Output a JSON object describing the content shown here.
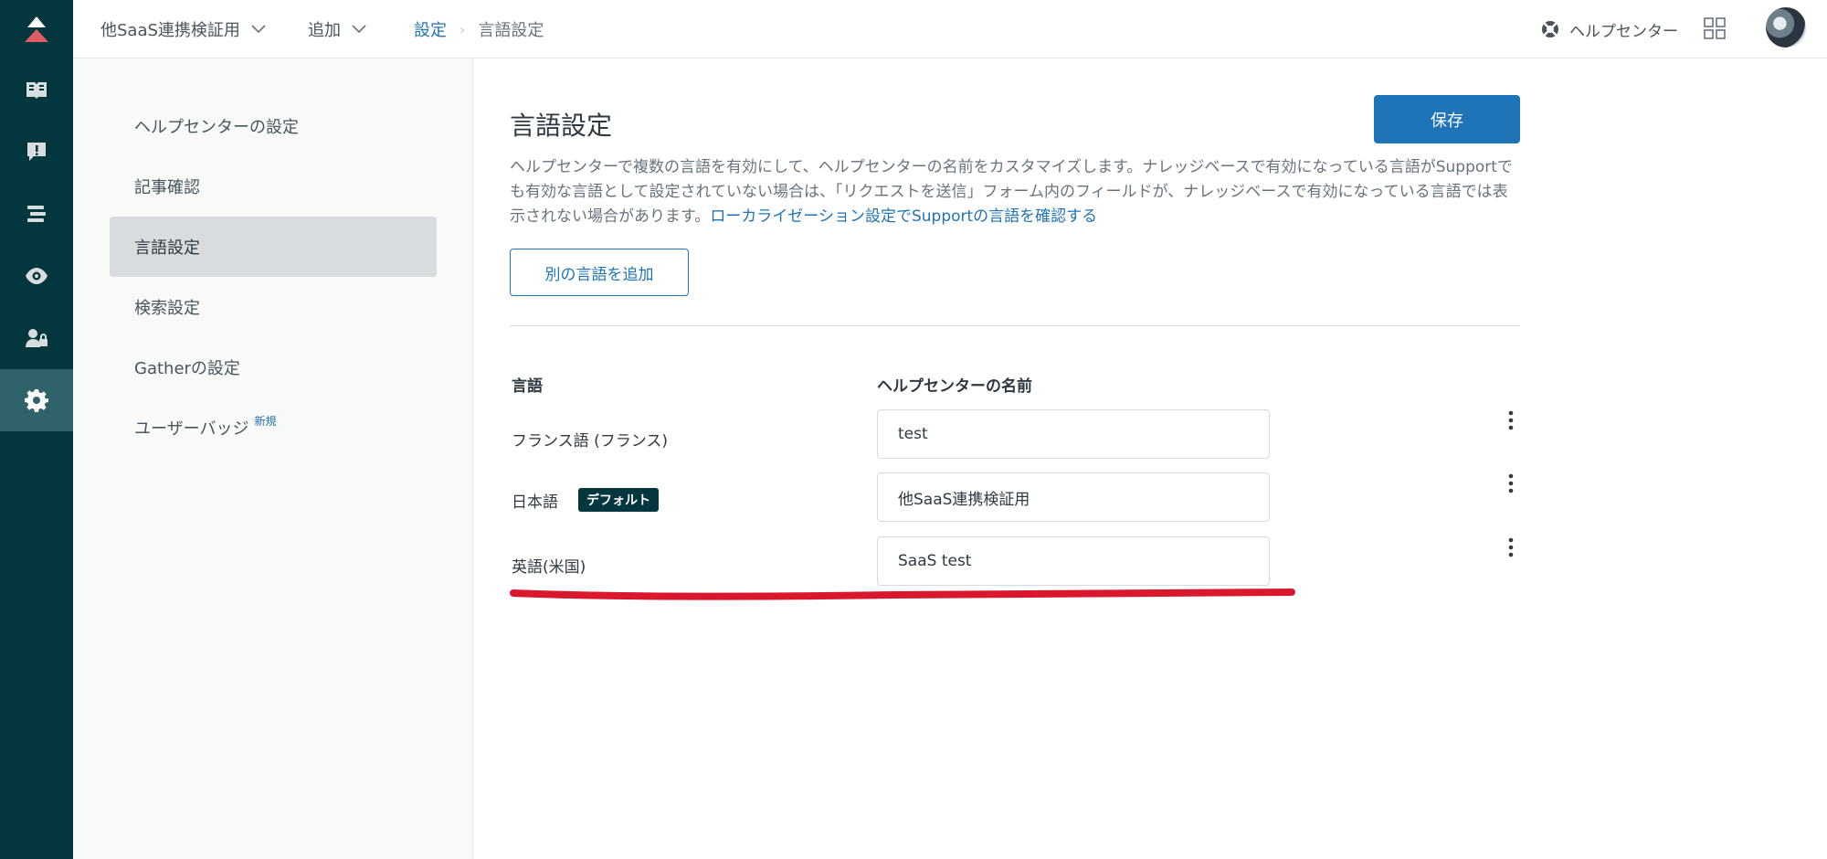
{
  "topbar": {
    "workspace_label": "他SaaS連携検証用",
    "add_label": "追加",
    "breadcrumb_parent": "設定",
    "breadcrumb_current": "言語設定",
    "help_center_label": "ヘルプセンター"
  },
  "sidebar": {
    "items": [
      {
        "label": "ヘルプセンターの設定"
      },
      {
        "label": "記事確認"
      },
      {
        "label": "言語設定",
        "active": true
      },
      {
        "label": "検索設定"
      },
      {
        "label": "Gatherの設定"
      },
      {
        "label": "ユーザーバッジ",
        "tag": "新規"
      }
    ]
  },
  "main": {
    "title": "言語設定",
    "save_label": "保存",
    "description": "ヘルプセンターで複数の言語を有効にして、ヘルプセンターの名前をカスタマイズします。ナレッジベースで有効になっている言語がSupportでも有効な言語として設定されていない場合は、「リクエストを送信」フォーム内のフィールドが、ナレッジベースで有効になっている言語では表示されない場合があります。",
    "description_link": "ローカライゼーション設定でSupportの言語を確認する",
    "add_language_label": "別の言語を追加",
    "col_language": "言語",
    "col_name": "ヘルプセンターの名前",
    "rows": [
      {
        "language": "フランス語 (フランス)",
        "name": "test"
      },
      {
        "language": "日本語",
        "badge": "デフォルト",
        "name": "他SaaS連携検証用"
      },
      {
        "language": "英語(米国)",
        "name": "SaaS test"
      }
    ]
  },
  "colors": {
    "rail_bg": "#03363d",
    "rail_active": "#30626a",
    "primary": "#1f73b7",
    "brand_red": "#e35b66",
    "annotation": "#d9182e"
  }
}
